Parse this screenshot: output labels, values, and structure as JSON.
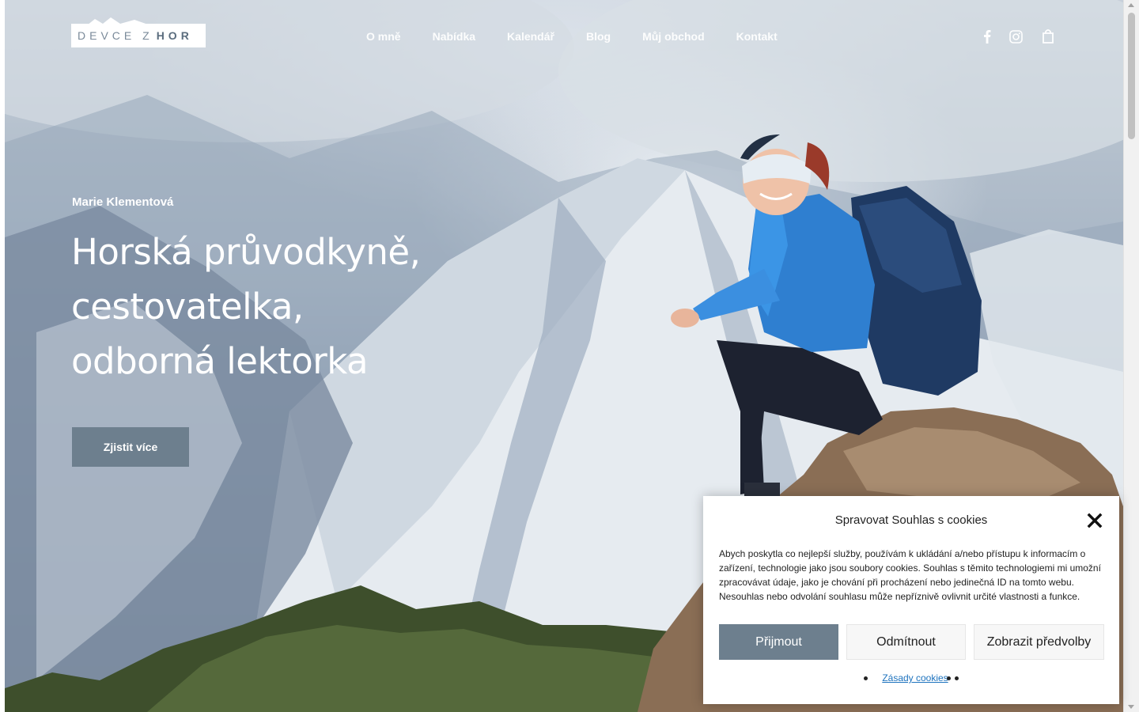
{
  "brand": {
    "logo_light": "DEVCE Z",
    "logo_bold": "HOR"
  },
  "nav": {
    "items": [
      "O mně",
      "Nabídka",
      "Kalendář",
      "Blog",
      "Můj obchod",
      "Kontakt"
    ]
  },
  "header_icons": [
    "facebook-icon",
    "instagram-icon",
    "shopping-bag-icon"
  ],
  "hero": {
    "subtitle": "Marie Klementová",
    "headline_lines": [
      "Horská průvodkyně,",
      "cestovatelka,",
      "odborná lektorka"
    ],
    "cta_label": "Zjistit více"
  },
  "cookie": {
    "title": "Spravovat Souhlas s cookies",
    "text": "Abych poskytla co nejlepší služby, používám k ukládání a/nebo přístupu k informacím o zařízení, technologie jako jsou soubory cookies. Souhlas s těmito technologiemi mi umožní zpracovávat údaje, jako je chování při procházení nebo jedinečná ID na tomto webu. Nesouhlas nebo odvolání souhlasu může nepříznivě ovlivnit určité vlastnosti a funkce.",
    "accept_label": "Přijmout",
    "deny_label": "Odmítnout",
    "prefs_label": "Zobrazit předvolby",
    "policy_link": "Zásady cookies"
  },
  "colors": {
    "accent": "#6d7f8e",
    "link": "#1e73be"
  }
}
